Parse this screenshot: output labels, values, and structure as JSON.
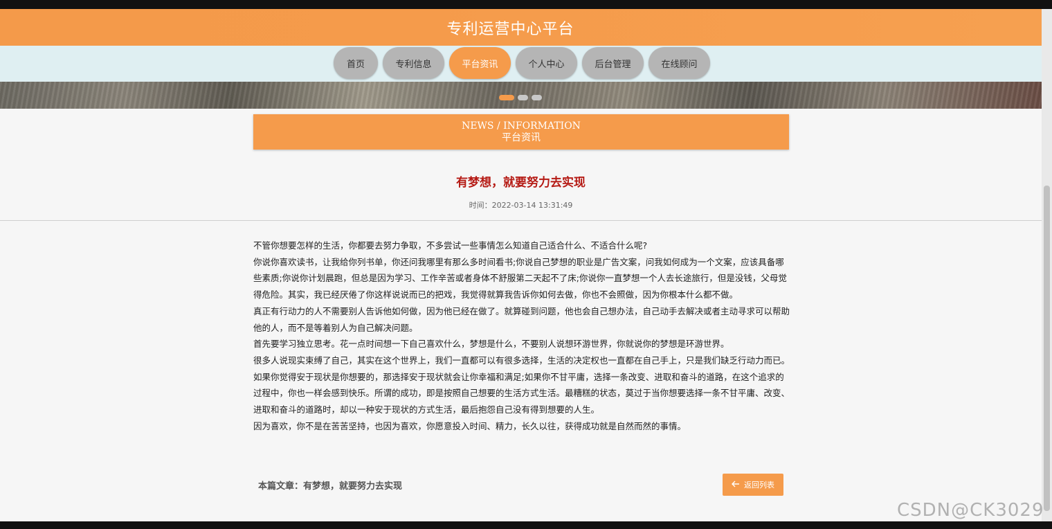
{
  "site": {
    "title": "专利运营中心平台"
  },
  "nav": {
    "items": [
      {
        "label": "首页",
        "active": false
      },
      {
        "label": "专利信息",
        "active": false
      },
      {
        "label": "平台资讯",
        "active": true
      },
      {
        "label": "个人中心",
        "active": false
      },
      {
        "label": "后台管理",
        "active": false
      },
      {
        "label": "在线顾问",
        "active": false
      }
    ]
  },
  "section": {
    "en": "NEWS / INFORMATION",
    "cn": "平台资讯"
  },
  "article": {
    "title": "有梦想，就要努力去实现",
    "time": "时间：2022-03-14 13:31:49",
    "paragraphs": [
      "不管你想要怎样的生活，你都要去努力争取，不多尝试一些事情怎么知道自己适合什么、不适合什么呢?",
      "你说你喜欢读书，让我给你列书单，你还问我哪里有那么多时间看书;你说自己梦想的职业是广告文案，问我如何成为一个文案，应该具备哪些素质;你说你计划晨跑，但总是因为学习、工作辛苦或者身体不舒服第二天起不了床;你说你一直梦想一个人去长途旅行，但是没钱，父母觉得危险。其实，我已经厌倦了你这样说说而已的把戏，我觉得就算我告诉你如何去做，你也不会照做，因为你根本什么都不做。",
      "真正有行动力的人不需要别人告诉他如何做，因为他已经在做了。就算碰到问题，他也会自己想办法，自己动手去解决或者主动寻求可以帮助他的人，而不是等着别人为自己解决问题。",
      "首先要学习独立思考。花一点时间想一下自己喜欢什么，梦想是什么，不要别人说想环游世界，你就说你的梦想是环游世界。",
      "很多人说现实束缚了自己，其实在这个世界上，我们一直都可以有很多选择，生活的决定权也一直都在自己手上，只是我们缺乏行动力而已。",
      "如果你觉得安于现状是你想要的，那选择安于现状就会让你幸福和满足;如果你不甘平庸，选择一条改变、进取和奋斗的道路，在这个追求的过程中，你也一样会感到快乐。所谓的成功，即是按照自己想要的生活方式生活。最糟糕的状态，莫过于当你想要选择一条不甘平庸、改变、进取和奋斗的道路时，却以一种安于现状的方式生活，最后抱怨自己没有得到想要的人生。",
      "因为喜欢，你不是在苦苦坚持，也因为喜欢，你愿意投入时间、精力，长久以往，获得成功就是自然而然的事情。"
    ]
  },
  "footer": {
    "current_label": "本篇文章：有梦想，就要努力去实现",
    "back_label": "返回列表",
    "back_icon": "arrow-left-icon"
  },
  "carousel": {
    "slides": 3,
    "active_index": 0
  },
  "watermark": "CSDN@CK3029",
  "colors": {
    "accent": "#f59b4b",
    "title_red": "#b51a14",
    "nav_band": "#dfeff2",
    "nav_inactive": "#b5b5b5"
  }
}
